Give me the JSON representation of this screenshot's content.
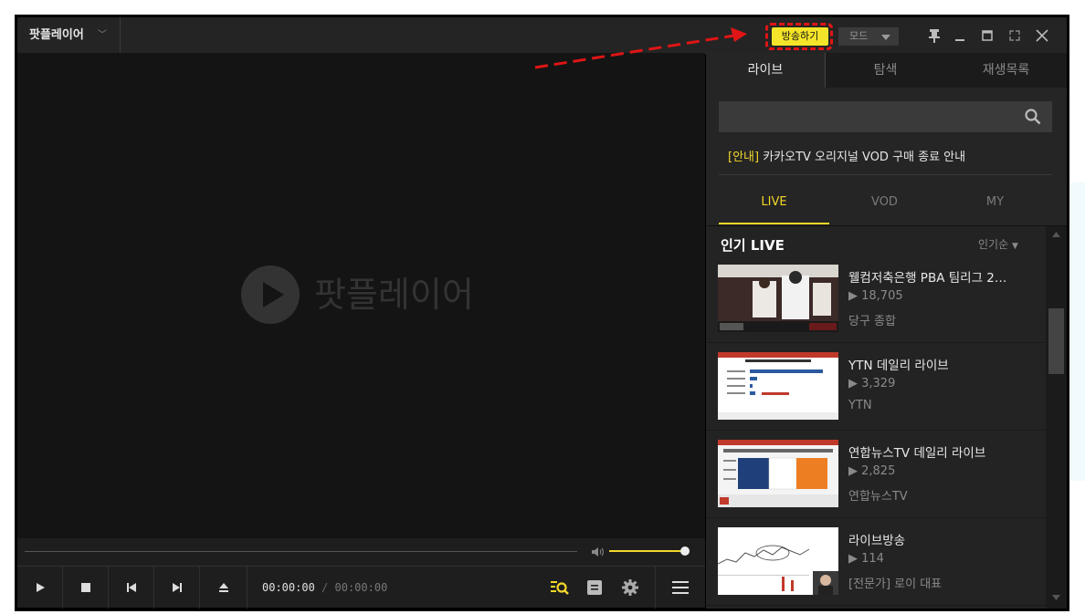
{
  "titlebar": {
    "app_title": "팟플레이어",
    "broadcast_label": "방송하기",
    "mode_label": "모드"
  },
  "icons": {
    "pin": "pin-icon",
    "minimize": "minimize-icon",
    "maximize": "maximize-icon",
    "fullscreen": "fullscreen-icon",
    "close": "close-icon"
  },
  "player": {
    "splash_label": "팟플레이어",
    "time_current": "00:00:00",
    "time_separator": "/",
    "time_total": "00:00:00",
    "volume_level": 0.95
  },
  "panel": {
    "tabs": [
      {
        "label": "라이브",
        "active": true
      },
      {
        "label": "탐색",
        "active": false
      },
      {
        "label": "재생목록",
        "active": false
      }
    ],
    "notice_tag": "[안내]",
    "notice_text": " 카카오TV 오리지널 VOD 구매 종료 안내",
    "subtabs": [
      {
        "label": "LIVE",
        "active": true
      },
      {
        "label": "VOD",
        "active": false
      },
      {
        "label": "MY",
        "active": false
      }
    ],
    "list_heading": "인기 LIVE",
    "sort_label": "인기순",
    "items": [
      {
        "title": "웰컴저축은행 PBA 팀리그 2…",
        "views": "▶ 18,705",
        "channel": "당구 종합"
      },
      {
        "title": "YTN 데일리 라이브",
        "views": "▶ 3,329",
        "channel": "YTN"
      },
      {
        "title": "연합뉴스TV 데일리 라이브",
        "views": "▶ 2,825",
        "channel": "연합뉴스TV"
      },
      {
        "title": "라이브방송",
        "views": "▶ 114",
        "channel": "[전문가] 로이 대표"
      }
    ]
  },
  "colors": {
    "accent": "#f2d72a",
    "highlight": "#e01515"
  }
}
